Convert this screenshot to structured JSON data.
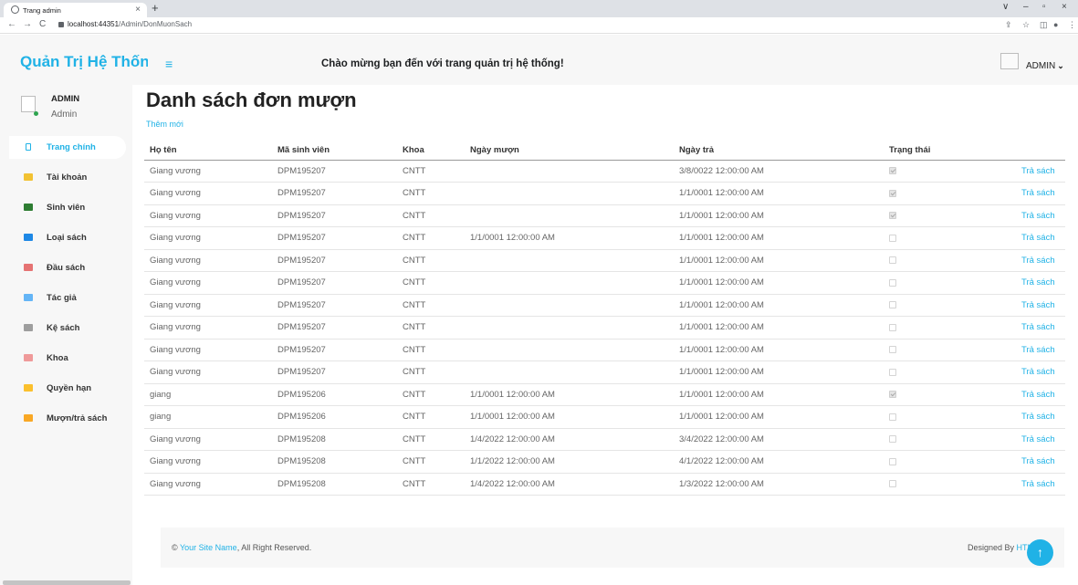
{
  "browser": {
    "tab_title": "Trang admin",
    "tab_close": "×",
    "new_tab": "+",
    "url_host": "localhost:44351",
    "url_path": "/Admin/DonMuonSach",
    "back": "←",
    "forward": "→",
    "reload": "C",
    "minimize": "–",
    "maximize": "▫",
    "close": "×",
    "tab_search": "∨",
    "share": "⇪",
    "star": "☆",
    "panel": "◫",
    "profile": "●",
    "more": "⋮"
  },
  "topbar": {
    "brand": "Quản Trị Hệ Thống",
    "menu_icon": "≡",
    "welcome": "Chào mừng bạn đến với trang quản trị hệ thống!",
    "user": "ADMIN",
    "caret": "⌄"
  },
  "sidebar": {
    "profile_name": "ADMIN",
    "profile_role": "Admin",
    "items": [
      {
        "label": "Trang chính",
        "icon": "home-icon",
        "color": "#20b2e6"
      },
      {
        "label": "Tài khoản",
        "icon": "account-icon",
        "color": "#f2c233"
      },
      {
        "label": "Sinh viên",
        "icon": "student-icon",
        "color": "#2e7d32"
      },
      {
        "label": "Loại sách",
        "icon": "chart-icon",
        "color": "#1e88e5"
      },
      {
        "label": "Đầu sách",
        "icon": "book-icon",
        "color": "#e57373"
      },
      {
        "label": "Tác giả",
        "icon": "author-icon",
        "color": "#64b5f6"
      },
      {
        "label": "Kệ sách",
        "icon": "shelf-icon",
        "color": "#9e9e9e"
      },
      {
        "label": "Khoa",
        "icon": "faculty-icon",
        "color": "#ef9a9a"
      },
      {
        "label": "Quyền hạn",
        "icon": "permission-icon",
        "color": "#fbc02d"
      },
      {
        "label": "Mượn/trả sách",
        "icon": "borrow-icon",
        "color": "#f9a825"
      }
    ]
  },
  "main": {
    "title": "Danh sách đơn mượn",
    "add_link": "Thêm mới",
    "columns": [
      "Họ tên",
      "Mã sinh viên",
      "Khoa",
      "Ngày mượn",
      "Ngày trả",
      "Trạng thái",
      ""
    ],
    "action_label": "Trả sách",
    "rows": [
      {
        "name": "Giang vương",
        "id": "DPM195207",
        "faculty": "CNTT",
        "borrow": "",
        "return": "3/8/0022 12:00:00 AM",
        "status": true
      },
      {
        "name": "Giang vương",
        "id": "DPM195207",
        "faculty": "CNTT",
        "borrow": "",
        "return": "1/1/0001 12:00:00 AM",
        "status": true
      },
      {
        "name": "Giang vương",
        "id": "DPM195207",
        "faculty": "CNTT",
        "borrow": "",
        "return": "1/1/0001 12:00:00 AM",
        "status": true
      },
      {
        "name": "Giang vương",
        "id": "DPM195207",
        "faculty": "CNTT",
        "borrow": "1/1/0001 12:00:00 AM",
        "return": "1/1/0001 12:00:00 AM",
        "status": false
      },
      {
        "name": "Giang vương",
        "id": "DPM195207",
        "faculty": "CNTT",
        "borrow": "",
        "return": "1/1/0001 12:00:00 AM",
        "status": false
      },
      {
        "name": "Giang vương",
        "id": "DPM195207",
        "faculty": "CNTT",
        "borrow": "",
        "return": "1/1/0001 12:00:00 AM",
        "status": false
      },
      {
        "name": "Giang vương",
        "id": "DPM195207",
        "faculty": "CNTT",
        "borrow": "",
        "return": "1/1/0001 12:00:00 AM",
        "status": false
      },
      {
        "name": "Giang vương",
        "id": "DPM195207",
        "faculty": "CNTT",
        "borrow": "",
        "return": "1/1/0001 12:00:00 AM",
        "status": false
      },
      {
        "name": "Giang vương",
        "id": "DPM195207",
        "faculty": "CNTT",
        "borrow": "",
        "return": "1/1/0001 12:00:00 AM",
        "status": false
      },
      {
        "name": "Giang vương",
        "id": "DPM195207",
        "faculty": "CNTT",
        "borrow": "",
        "return": "1/1/0001 12:00:00 AM",
        "status": false
      },
      {
        "name": "giang",
        "id": "DPM195206",
        "faculty": "CNTT",
        "borrow": "1/1/0001 12:00:00 AM",
        "return": "1/1/0001 12:00:00 AM",
        "status": true
      },
      {
        "name": "giang",
        "id": "DPM195206",
        "faculty": "CNTT",
        "borrow": "1/1/0001 12:00:00 AM",
        "return": "1/1/0001 12:00:00 AM",
        "status": false
      },
      {
        "name": "Giang vương",
        "id": "DPM195208",
        "faculty": "CNTT",
        "borrow": "1/4/2022 12:00:00 AM",
        "return": "3/4/2022 12:00:00 AM",
        "status": false
      },
      {
        "name": "Giang vương",
        "id": "DPM195208",
        "faculty": "CNTT",
        "borrow": "1/1/2022 12:00:00 AM",
        "return": "4/1/2022 12:00:00 AM",
        "status": false
      },
      {
        "name": "Giang vương",
        "id": "DPM195208",
        "faculty": "CNTT",
        "borrow": "1/4/2022 12:00:00 AM",
        "return": "1/3/2022 12:00:00 AM",
        "status": false
      }
    ]
  },
  "footer": {
    "copyright_prefix": "© ",
    "site_name": "Your Site Name",
    "copyright_suffix": ", All Right Reserved.",
    "designed_by": "Designed By ",
    "designer": "HTML",
    "to_top": "↑"
  }
}
